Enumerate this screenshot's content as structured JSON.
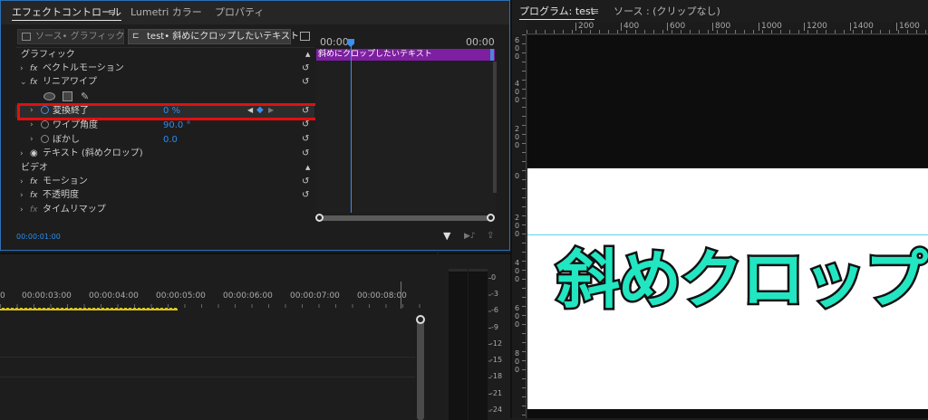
{
  "effect_panel": {
    "tabs": [
      "エフェクトコントロール",
      "Lumetri カラー",
      "プロパティ"
    ],
    "tab_menu_glyph": "≡",
    "source_chip": "ソース• グラフィック",
    "clip_chip": "test• 斜めにクロップしたいテキスト",
    "timecodes": [
      "00:00",
      "00:00"
    ],
    "clip_bar_label": "斜めにクロップしたいテキスト",
    "clip_bar_color": "#7d1fa0",
    "rows": [
      {
        "label": "グラフィック",
        "value": ""
      },
      {
        "label": "ベクトルモーション",
        "value": ""
      },
      {
        "label": "リニアワイプ",
        "value": ""
      },
      {
        "label": "変換終了",
        "value": "0 %"
      },
      {
        "label": "ワイプ角度",
        "value": "90.0 °"
      },
      {
        "label": "ぼかし",
        "value": "0.0"
      },
      {
        "label": "テキスト (斜めクロップ)",
        "value": ""
      },
      {
        "label": "ビデオ",
        "value": ""
      },
      {
        "label": "モーション",
        "value": ""
      },
      {
        "label": "不透明度",
        "value": ""
      },
      {
        "label": "タイムリマップ",
        "value": ""
      }
    ],
    "fx_glyph": "fx",
    "current_time": "00:00:01:00",
    "highlight_color": "#e01010"
  },
  "program_panel": {
    "tab_program": "プログラム: test",
    "tab_menu_glyph": "≡",
    "tab_source": "ソース : (クリップなし)",
    "ruler_h": [
      "200",
      "400",
      "600",
      "800",
      "1000",
      "1200",
      "1400",
      "1600"
    ],
    "ruler_v": [
      "6\n0\n0",
      "4\n0\n0",
      "2\n0\n0",
      "0",
      "2\n0\n0",
      "4\n0\n0",
      "6\n0\n0",
      "8\n0\n0"
    ],
    "preview_text": "斜めクロップ",
    "text_color": "#21e6c1"
  },
  "timeline": {
    "times": [
      "00:00:03:00",
      "00:00:04:00",
      "00:00:05:00",
      "00:00:06:00",
      "00:00:07:00",
      "00:00:08:00"
    ],
    "first_tick": "0",
    "work_area_color": "#d8c31c"
  },
  "audio_meter": {
    "scale": [
      "0",
      "-3",
      "-6",
      "-9",
      "-12",
      "-15",
      "-18",
      "-21",
      "-24"
    ]
  }
}
